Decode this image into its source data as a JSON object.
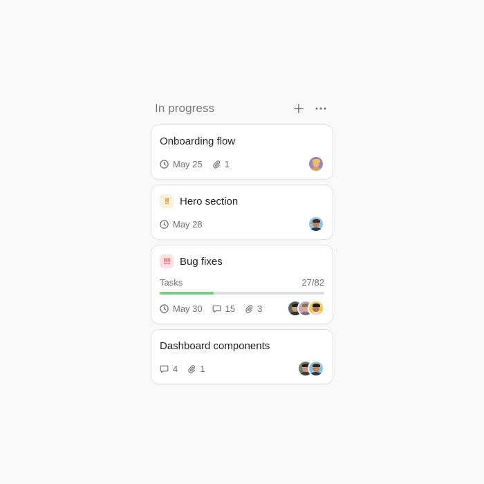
{
  "column": {
    "title": "In progress",
    "add_icon": "plus-icon",
    "more_icon": "ellipsis-icon"
  },
  "cards": [
    {
      "title": "Onboarding flow",
      "due": "May 25",
      "attachments": "1",
      "avatars": [
        "avatar-purple"
      ]
    },
    {
      "title": "Hero section",
      "priority": "!!",
      "priority_level": "medium",
      "due": "May 28",
      "avatars": [
        "avatar-blue"
      ]
    },
    {
      "title": "Bug fixes",
      "priority": "!!!",
      "priority_level": "high",
      "progress_label": "Tasks",
      "progress_count": "27/82",
      "progress_fraction": 0.3293,
      "due": "May 30",
      "comments": "15",
      "attachments": "3",
      "avatars": [
        "avatar-dark",
        "avatar-pink",
        "avatar-yellow"
      ]
    },
    {
      "title": "Dashboard components",
      "comments": "4",
      "attachments": "1",
      "avatars": [
        "avatar-green",
        "avatar-blue"
      ]
    }
  ],
  "colors": {
    "accent_progress": "#79c97f",
    "priority_medium": "#d68a1c",
    "priority_high": "#d94040",
    "background": "#f9f9f9"
  }
}
